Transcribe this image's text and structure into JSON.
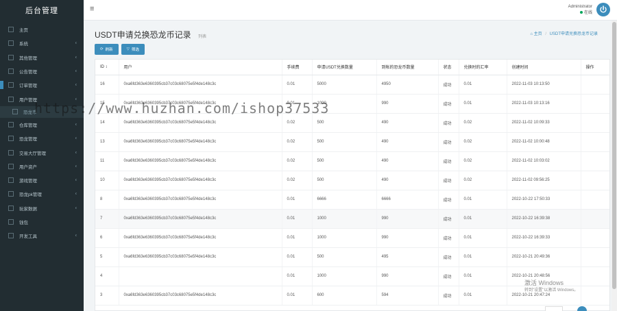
{
  "brand": "后台管理",
  "sidebar": {
    "items": [
      {
        "label": "主页",
        "arrow": ""
      },
      {
        "label": "系统",
        "arrow": "‹"
      },
      {
        "label": "其他管理",
        "arrow": "‹"
      },
      {
        "label": "公告管理",
        "arrow": "‹"
      },
      {
        "label": "订单管理",
        "arrow": "‹"
      },
      {
        "label": "用户管理",
        "arrow": "‹"
      },
      {
        "label": "恐龙币",
        "arrow": ""
      },
      {
        "label": "仓库管理",
        "arrow": "‹"
      },
      {
        "label": "恐龙管理",
        "arrow": "‹"
      },
      {
        "label": "交易大厅管理",
        "arrow": "‹"
      },
      {
        "label": "用户资产",
        "arrow": "‹"
      },
      {
        "label": "游戏管理",
        "arrow": "‹"
      },
      {
        "label": "恐龙pk管理",
        "arrow": "‹"
      },
      {
        "label": "玩家数据",
        "arrow": "‹"
      },
      {
        "label": "钱包",
        "arrow": ""
      },
      {
        "label": "开发工具",
        "arrow": "‹"
      }
    ]
  },
  "header": {
    "hamburger": "≡",
    "username": "Administrator",
    "status": "在线"
  },
  "page": {
    "title": "USDT申请兑换恐龙币记录",
    "subtitle": "列表",
    "breadcrumb_home": "主页",
    "breadcrumb_current": "USDT申请兑换恐龙币记录"
  },
  "toolbar": {
    "refresh_label": "刷新",
    "filter_label": "筛选"
  },
  "table": {
    "columns": [
      "ID ↕",
      "用户",
      "手续费",
      "申请USDT兑换数量",
      "到帐的恐龙币数量",
      "状态",
      "兑换时的汇率",
      "创建时间",
      "操作"
    ],
    "rows": [
      {
        "id": "16",
        "user": "0xa6fd363e6360395cb37c03c68075e5f4de148c3c",
        "fee": "0.01",
        "usdt": "5000",
        "coin": "4950",
        "status": "成功",
        "rate": "0.01",
        "time": "2022-11-03 10:13:50"
      },
      {
        "id": "15",
        "user": "0xa6fd363e6360395cb37c03c68075e5f4de148c3c",
        "fee": "0.01",
        "usdt": "1000",
        "coin": "990",
        "status": "成功",
        "rate": "0.01",
        "time": "2022-11-03 10:13:16"
      },
      {
        "id": "14",
        "user": "0xa6fd363e6360395cb37c03c68075e5f4de148c3c",
        "fee": "0.02",
        "usdt": "500",
        "coin": "490",
        "status": "成功",
        "rate": "0.02",
        "time": "2022-11-02 10:09:33"
      },
      {
        "id": "13",
        "user": "0xa6fd363e6360395cb37c03c68075e5f4de148c3c",
        "fee": "0.02",
        "usdt": "500",
        "coin": "490",
        "status": "成功",
        "rate": "0.02",
        "time": "2022-11-02 10:00:48"
      },
      {
        "id": "11",
        "user": "0xa6fd363e6360395cb37c03c68075e5f4de148c3c",
        "fee": "0.02",
        "usdt": "500",
        "coin": "490",
        "status": "成功",
        "rate": "0.02",
        "time": "2022-11-02 10:03:02"
      },
      {
        "id": "10",
        "user": "0xa6fd363e6360395cb37c03c68075e5f4de148c3c",
        "fee": "0.02",
        "usdt": "500",
        "coin": "490",
        "status": "成功",
        "rate": "0.02",
        "time": "2022-11-02 09:56:25"
      },
      {
        "id": "8",
        "user": "0xa6fd363e6360395cb37c03c68075e5f4de148c3c",
        "fee": "0.01",
        "usdt": "6666",
        "coin": "6666",
        "status": "成功",
        "rate": "0.01",
        "time": "2022-10-22 17:50:33"
      },
      {
        "id": "7",
        "user": "0xa6fd363e6360395cb37c03c68075e5f4de148c3c",
        "fee": "0.01",
        "usdt": "1000",
        "coin": "990",
        "status": "成功",
        "rate": "0.01",
        "time": "2022-10-22 16:39:38"
      },
      {
        "id": "6",
        "user": "0xa6fd363e6360395cb37c03c68075e5f4de148c3c",
        "fee": "0.01",
        "usdt": "1000",
        "coin": "990",
        "status": "成功",
        "rate": "0.01",
        "time": "2022-10-22 16:39:33"
      },
      {
        "id": "5",
        "user": "0xa6fd363e6360395cb37c03c68075e5f4de148c3c",
        "fee": "0.01",
        "usdt": "500",
        "coin": "495",
        "status": "成功",
        "rate": "0.01",
        "time": "2022-10-21 20:49:36"
      },
      {
        "id": "4",
        "user": "",
        "fee": "0.01",
        "usdt": "1000",
        "coin": "990",
        "status": "成功",
        "rate": "0.01",
        "time": "2022-10-21 20:48:56"
      },
      {
        "id": "3",
        "user": "0xa6fd363e6360395cb37c03c68075e5f4de148c3c",
        "fee": "0.01",
        "usdt": "600",
        "coin": "594",
        "status": "成功",
        "rate": "0.01",
        "time": "2022-10-21 20:47:24"
      }
    ]
  },
  "watermark_url": "https://www.huzhan.com/ishop37533",
  "windows_activation": {
    "line1": "激活 Windows",
    "line2": "转到\"设置\"以激活 Windows。"
  },
  "colors": {
    "sidebar_bg": "#222d32",
    "accent": "#3c8dbc",
    "status_online": "#00a65a"
  }
}
